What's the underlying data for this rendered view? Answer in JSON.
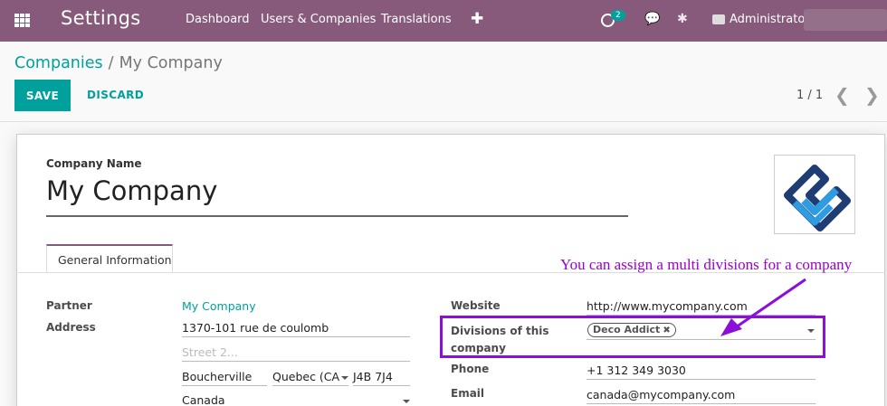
{
  "navbar": {
    "app_title": "Settings",
    "menu": [
      "Dashboard",
      "Users & Companies",
      "Translations"
    ],
    "activity_count": "2",
    "user_name": "Administrator"
  },
  "breadcrumb": {
    "parent": "Companies",
    "separator": "/",
    "current": "My Company"
  },
  "toolbar": {
    "save_label": "SAVE",
    "discard_label": "DISCARD"
  },
  "pager": {
    "value": "1 / 1"
  },
  "form": {
    "company_name_label": "Company Name",
    "company_name": "My Company",
    "tab_general": "General Information",
    "partner_label": "Partner",
    "partner_value": "My Company",
    "address_label": "Address",
    "street": "1370-101 rue de coulomb",
    "street2_placeholder": "Street 2...",
    "city": "Boucherville",
    "state": "Quebec (CA",
    "zip": "J4B 7J4",
    "country": "Canada",
    "website_label": "Website",
    "website_value": "http://www.mycompany.com",
    "divisions_label": "Divisions of this company",
    "divisions_tags": [
      "Deco Addict"
    ],
    "phone_label": "Phone",
    "phone_value": "+1 312 349 3030",
    "email_label": "Email",
    "email_value": "canada@mycompany.com"
  },
  "annotation": {
    "text": "You can assign a multi divisions for a company",
    "color": "#8a0fd8"
  },
  "colors": {
    "navbar": "#875a7b",
    "accent": "#00a09d"
  }
}
